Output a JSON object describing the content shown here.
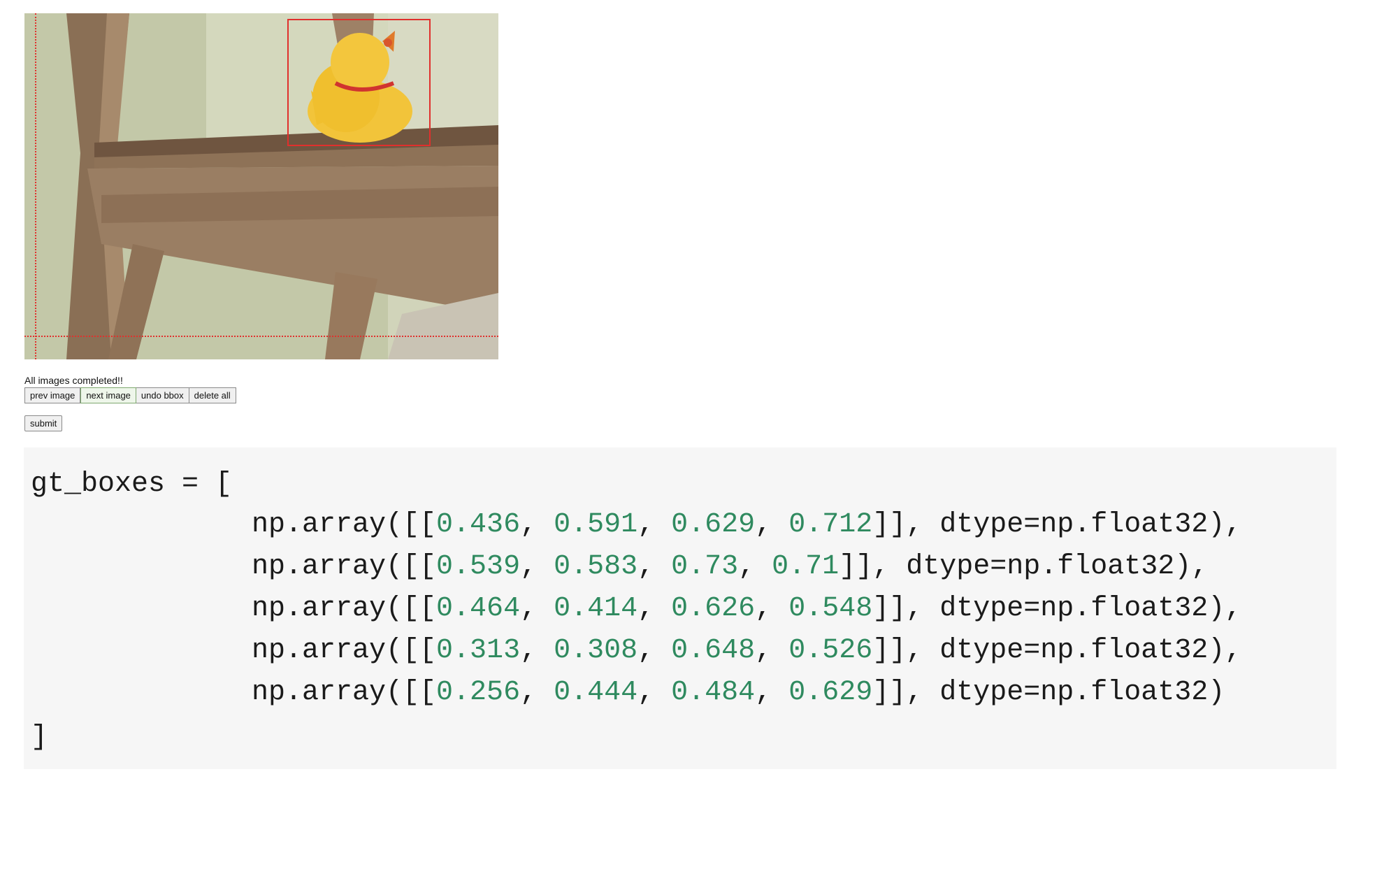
{
  "annotator": {
    "status_text": "All images completed!!",
    "buttons": {
      "prev": "prev image",
      "next": "next image",
      "undo": "undo bbox",
      "delete_all": "delete all",
      "submit": "submit"
    },
    "colors": {
      "bbox": "#e0302d",
      "number": "#2f8a5f",
      "code_bg": "#f6f6f6"
    }
  },
  "code": {
    "header": "gt_boxes = [",
    "prefix": "np.array([[",
    "rows": [
      {
        "v1": "0.436",
        "v2": "0.591",
        "v3": "0.629",
        "v4": "0.712",
        "suffix": "]], dtype=np.float32),"
      },
      {
        "v1": "0.539",
        "v2": "0.583",
        "v3": "0.73",
        "v4": "0.71",
        "suffix": "]], dtype=np.float32),"
      },
      {
        "v1": "0.464",
        "v2": "0.414",
        "v3": "0.626",
        "v4": "0.548",
        "suffix": "]], dtype=np.float32),"
      },
      {
        "v1": "0.313",
        "v2": "0.308",
        "v3": "0.648",
        "v4": "0.526",
        "suffix": "]], dtype=np.float32),"
      },
      {
        "v1": "0.256",
        "v2": "0.444",
        "v3": "0.484",
        "v4": "0.629",
        "suffix": "]], dtype=np.float32)"
      }
    ],
    "footer": "]"
  }
}
